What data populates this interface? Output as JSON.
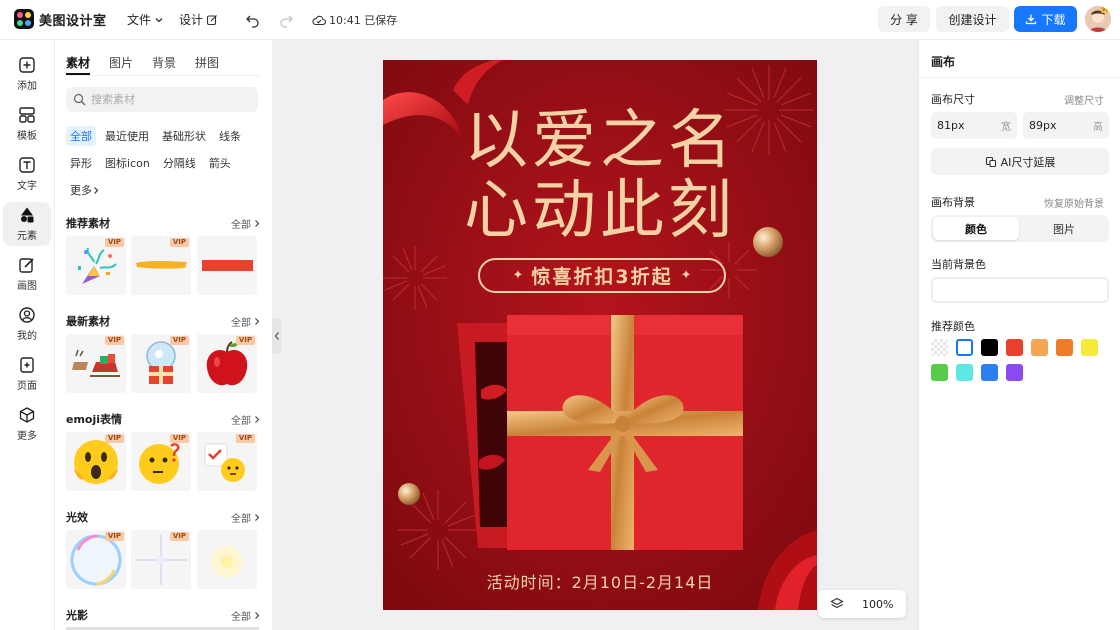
{
  "app": {
    "name": "美图设计室"
  },
  "topbar": {
    "file_menu": "文件",
    "design_menu": "设计",
    "save_status": "10:41 已保存",
    "share_label": "分 享",
    "create_label": "创建设计",
    "download_label": "下载",
    "accent_color": "#1677ff"
  },
  "rail": {
    "items": [
      {
        "label": "添加",
        "icon": "plus-square-icon"
      },
      {
        "label": "模板",
        "icon": "template-icon"
      },
      {
        "label": "文字",
        "icon": "text-icon"
      },
      {
        "label": "元素",
        "icon": "shapes-icon"
      },
      {
        "label": "画图",
        "icon": "pen-icon"
      },
      {
        "label": "我的",
        "icon": "user-icon"
      },
      {
        "label": "页面",
        "icon": "page-icon"
      },
      {
        "label": "更多",
        "icon": "cube-icon"
      }
    ],
    "active": "元素"
  },
  "material_panel": {
    "tabs": [
      "素材",
      "图片",
      "背景",
      "拼图"
    ],
    "active_tab": "素材",
    "search_placeholder": "搜索素材",
    "chips": [
      "全部",
      "最近使用",
      "基础形状",
      "线条",
      "异形",
      "图标icon",
      "分隔线",
      "箭头",
      "更多"
    ],
    "active_chip": "全部",
    "all_label": "全部",
    "vip_label": "VIP",
    "sections": [
      {
        "title": "推荐素材",
        "items": [
          "confetti-popper",
          "orange-brush-stroke",
          "red-rectangle"
        ]
      },
      {
        "title": "最新素材",
        "items": [
          "reindeer-sleigh",
          "snow-globe-gift",
          "red-apple"
        ]
      },
      {
        "title": "emoji表情",
        "items": [
          "shocked-emoji",
          "thinking-emoji",
          "calendar-emoji"
        ]
      },
      {
        "title": "光效",
        "items": [
          "rainbow-bubble",
          "light-flare",
          "soft-glow"
        ]
      },
      {
        "title": "光影",
        "items": []
      }
    ]
  },
  "poster": {
    "headline_line1": "以爱之名",
    "headline_line2": "心动此刻",
    "banner": "惊喜折扣3折起",
    "date_line": "活动时间：2月10日-2月14日",
    "bg_color": "#9c0f16",
    "gold_color": "#f3d3a6"
  },
  "zoom": {
    "value": "100%"
  },
  "right_panel": {
    "title": "画布",
    "size_label": "画布尺寸",
    "resize_link": "调整尺寸",
    "width_value": "81px",
    "width_unit": "宽",
    "height_value": "89px",
    "height_unit": "高",
    "ai_button": "AI尺寸延展",
    "bg_label": "画布背景",
    "restore_link": "恢复原始背景",
    "seg_color": "颜色",
    "seg_image": "图片",
    "current_bg_label": "当前背景色",
    "recommended_label": "推荐颜色",
    "swatches": [
      "transparent",
      "#ffffff",
      "#000000",
      "#e8412c",
      "#f5a452",
      "#f07b2b",
      "#f5ea3a",
      "#57cc4b",
      "#5ee8e4",
      "#2b7ff0",
      "#8a4bf0"
    ]
  }
}
